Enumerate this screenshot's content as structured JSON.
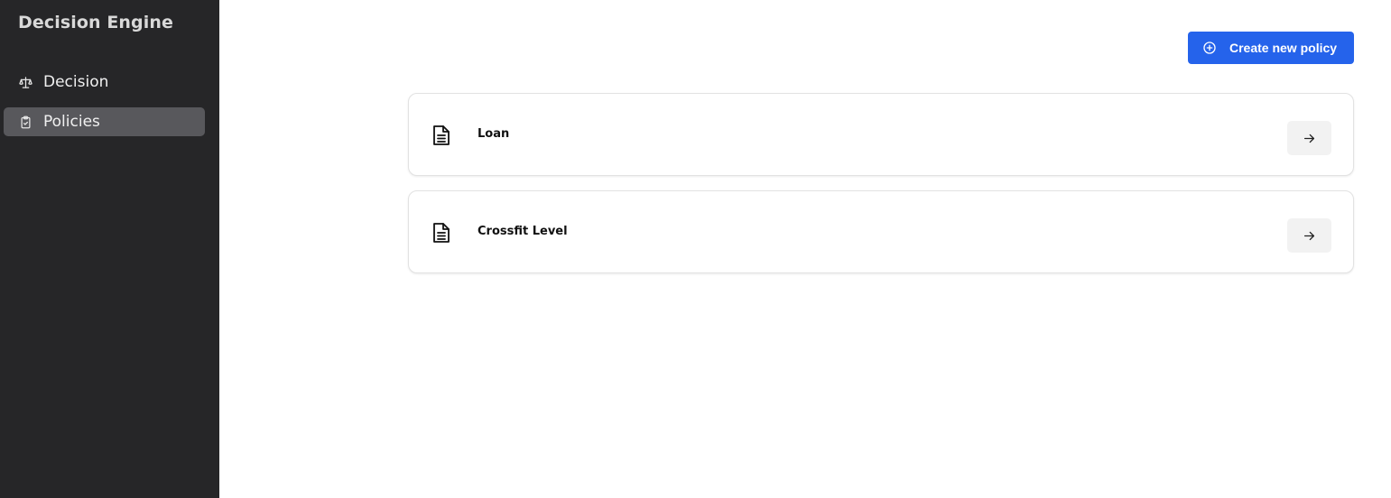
{
  "sidebar": {
    "brand": "Decision Engine",
    "items": [
      {
        "label": "Decision",
        "icon": "scale-icon",
        "active": false
      },
      {
        "label": "Policies",
        "icon": "clipboard-check-icon",
        "active": true
      }
    ],
    "background": "#262628",
    "active_background": "#58585c"
  },
  "header": {
    "create_button_label": "Create new policy",
    "create_button_icon": "plus-circle-icon",
    "accent": "#2563eb"
  },
  "policies": [
    {
      "name": "Loan",
      "icon": "document-icon",
      "action_icon": "arrow-right-icon"
    },
    {
      "name": "Crossfit Level",
      "icon": "document-icon",
      "action_icon": "arrow-right-icon"
    }
  ]
}
